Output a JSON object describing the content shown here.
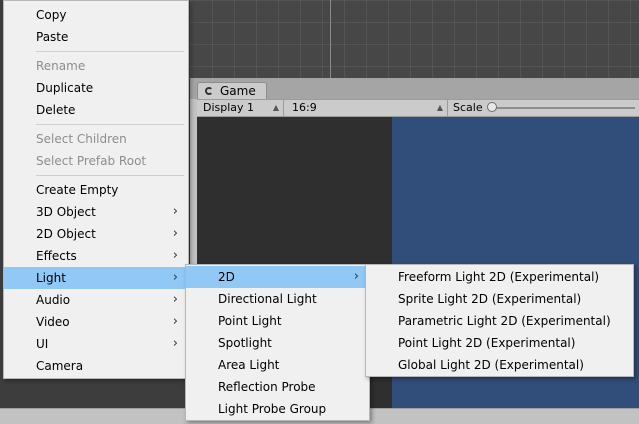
{
  "game_view": {
    "tab_label": "Game",
    "display_value": "Display 1",
    "aspect_value": "16:9",
    "scale_label": "Scale",
    "scale_level": 0.0,
    "colors": {
      "game_background": "#314d79",
      "menu_highlight": "#91c8f6"
    }
  },
  "context_menu": {
    "items": [
      {
        "label": "Copy",
        "enabled": true
      },
      {
        "label": "Paste",
        "enabled": true
      },
      {
        "label": "Rename",
        "enabled": false
      },
      {
        "label": "Duplicate",
        "enabled": true
      },
      {
        "label": "Delete",
        "enabled": true
      },
      {
        "label": "Select Children",
        "enabled": false
      },
      {
        "label": "Select Prefab Root",
        "enabled": false
      },
      {
        "label": "Create Empty",
        "enabled": true
      },
      {
        "label": "3D Object",
        "enabled": true,
        "submenu": true
      },
      {
        "label": "2D Object",
        "enabled": true,
        "submenu": true
      },
      {
        "label": "Effects",
        "enabled": true,
        "submenu": true
      },
      {
        "label": "Light",
        "enabled": true,
        "submenu": true,
        "active": true
      },
      {
        "label": "Audio",
        "enabled": true,
        "submenu": true
      },
      {
        "label": "Video",
        "enabled": true,
        "submenu": true
      },
      {
        "label": "UI",
        "enabled": true,
        "submenu": true
      },
      {
        "label": "Camera",
        "enabled": true
      }
    ]
  },
  "light_submenu": {
    "items": [
      {
        "label": "2D",
        "submenu": true,
        "active": true
      },
      {
        "label": "Directional Light"
      },
      {
        "label": "Point Light"
      },
      {
        "label": "Spotlight"
      },
      {
        "label": "Area Light"
      },
      {
        "label": "Reflection Probe"
      },
      {
        "label": "Light Probe Group"
      }
    ]
  },
  "light_2d_submenu": {
    "items": [
      {
        "label": "Freeform Light 2D (Experimental)"
      },
      {
        "label": "Sprite Light 2D (Experimental)"
      },
      {
        "label": "Parametric Light 2D (Experimental)"
      },
      {
        "label": "Point Light 2D (Experimental)"
      },
      {
        "label": "Global Light 2D (Experimental)"
      }
    ]
  }
}
